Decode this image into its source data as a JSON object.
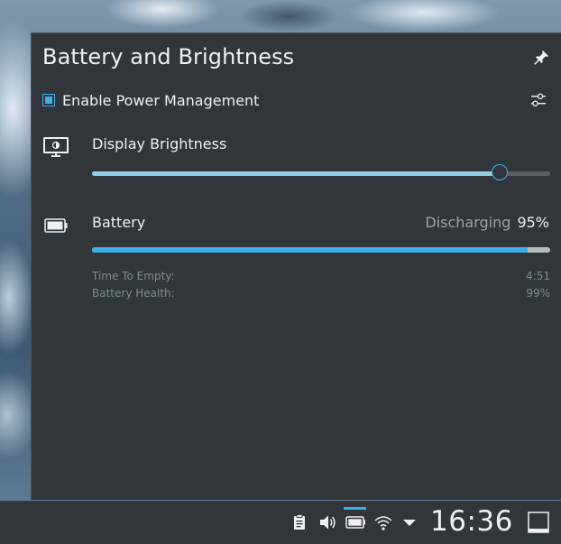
{
  "popup": {
    "title": "Battery and Brightness",
    "power_management": {
      "label": "Enable Power Management",
      "checked": true
    },
    "brightness": {
      "label": "Display Brightness",
      "level_percent": 89
    },
    "battery": {
      "label": "Battery",
      "state": "Discharging",
      "percent": "95%",
      "charge_fraction": 0.95,
      "details": [
        {
          "label": "Time To Empty:",
          "value": "4:51"
        },
        {
          "label": "Battery Health:",
          "value": "99%"
        }
      ]
    },
    "icons": {
      "pin": "pin-icon",
      "config": "configure-icon",
      "brightness": "display-brightness-icon",
      "battery": "battery-icon"
    }
  },
  "taskbar": {
    "clock": "16:36",
    "tray_icons": [
      "clipboard-icon",
      "volume-icon",
      "battery-icon",
      "wifi-icon",
      "expand-arrow-icon"
    ],
    "active_tray": "battery-icon"
  },
  "colors": {
    "accent": "#3daee9",
    "panel_bg": "#31363b",
    "text": "#eff0f1",
    "muted_text": "#7f8c8d"
  }
}
